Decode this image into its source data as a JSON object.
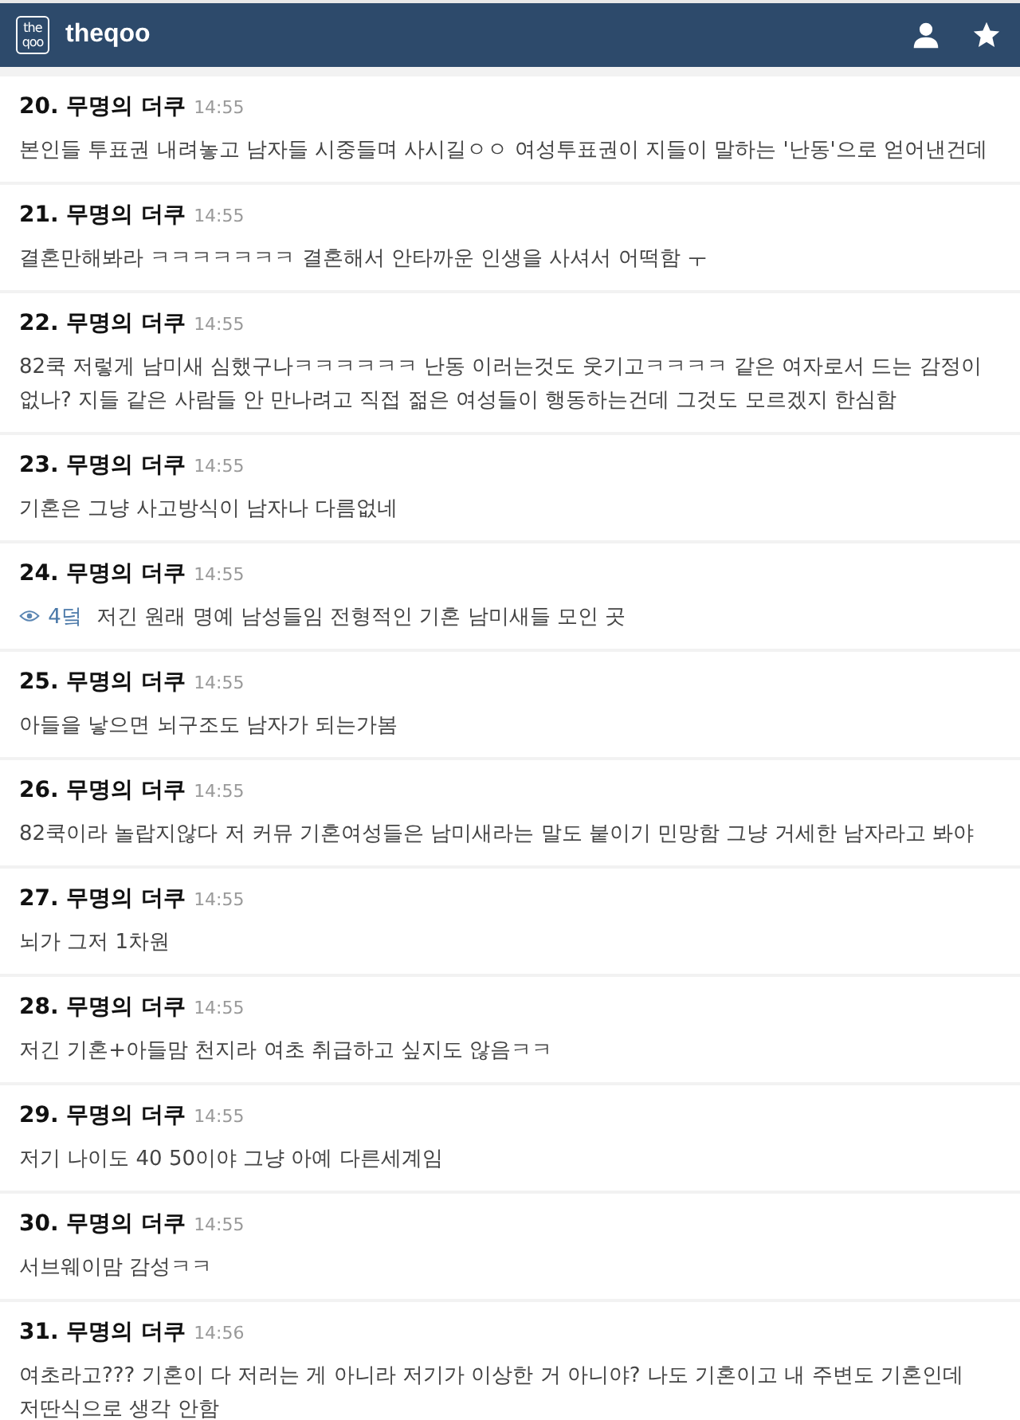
{
  "header": {
    "logo_lines": [
      "the",
      "qoo"
    ],
    "title": "theqoo"
  },
  "comments": [
    {
      "number": "20.",
      "author": "무명의 더쿠",
      "time": "14:55",
      "text": "본인들 투표권 내려놓고 남자들 시중들며 사시길ㅇㅇ 여성투표권이 지들이 말하는 '난동'으로 얻어낸건데"
    },
    {
      "number": "21.",
      "author": "무명의 더쿠",
      "time": "14:55",
      "text": "결혼만해봐라 ㅋㅋㅋㅋㅋㅋㅋ 결혼해서 안타까운 인생을 사셔서 어떡함 ㅜ"
    },
    {
      "number": "22.",
      "author": "무명의 더쿠",
      "time": "14:55",
      "text": "82쿡 저렇게 남미새 심했구나ㅋㅋㅋㅋㅋㅋ 난동 이러는것도 웃기고ㅋㅋㅋㅋ 같은 여자로서 드는 감정이 없나? 지들 같은 사람들 안 만나려고 직접 젊은 여성들이 행동하는건데 그것도 모르겠지 한심함"
    },
    {
      "number": "23.",
      "author": "무명의 더쿠",
      "time": "14:55",
      "text": "기혼은 그냥 사고방식이 남자나 다름없네"
    },
    {
      "number": "24.",
      "author": "무명의 더쿠",
      "time": "14:55",
      "reply_to": "4덬",
      "text": "저긴 원래 명예 남성들임 전형적인 기혼 남미새들 모인 곳"
    },
    {
      "number": "25.",
      "author": "무명의 더쿠",
      "time": "14:55",
      "text": "아들을 낳으면 뇌구조도 남자가 되는가봄"
    },
    {
      "number": "26.",
      "author": "무명의 더쿠",
      "time": "14:55",
      "text": "82쿡이라 놀랍지않다 저 커뮤 기혼여성들은 남미새라는 말도 붙이기 민망함 그냥 거세한 남자라고 봐야"
    },
    {
      "number": "27.",
      "author": "무명의 더쿠",
      "time": "14:55",
      "text": "뇌가 그저 1차원"
    },
    {
      "number": "28.",
      "author": "무명의 더쿠",
      "time": "14:55",
      "text": "저긴 기혼+아들맘 천지라 여초 취급하고 싶지도 않음ㅋㅋ"
    },
    {
      "number": "29.",
      "author": "무명의 더쿠",
      "time": "14:55",
      "text": "저기 나이도 40 50이야 그냥 아예 다른세계임"
    },
    {
      "number": "30.",
      "author": "무명의 더쿠",
      "time": "14:55",
      "text": "서브웨이맘 감성ㅋㅋ"
    },
    {
      "number": "31.",
      "author": "무명의 더쿠",
      "time": "14:56",
      "text": "여초라고??? 기혼이 다 저러는 게 아니라 저기가 이상한 거 아니야? 나도 기혼이고 내 주변도 기혼인데 저딴식으로 생각 안함"
    }
  ]
}
